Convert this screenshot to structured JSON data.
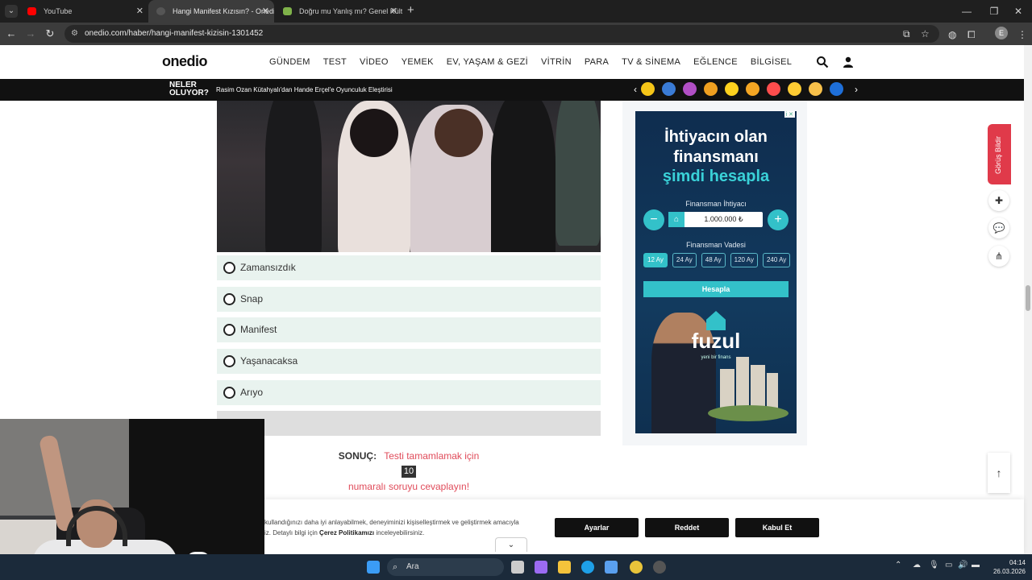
{
  "browser": {
    "tabs": [
      {
        "title": "YouTube",
        "favicon_color": "#ff0000",
        "active": false
      },
      {
        "title": "Hangi Manifest Kızısın? - Onedio",
        "favicon_color": "#555555",
        "active": true
      },
      {
        "title": "Doğru mu Yanlış mı? Genel Kültü...",
        "favicon_color": "#7fb24a",
        "active": false
      }
    ],
    "new_tab": "+",
    "url": "onedio.com/haber/hangi-manifest-kizisin-1301452",
    "profile_initial": "E"
  },
  "site": {
    "logo": "onedio",
    "menu": [
      "GÜNDEM",
      "TEST",
      "VİDEO",
      "YEMEK",
      "EV, YAŞAM & GEZİ",
      "VİTRİN",
      "PARA",
      "TV & SİNEMA",
      "EĞLENCE",
      "BİLGİSEL"
    ],
    "news_label_line1": "NELER",
    "news_label_line2": "OLUYOR?",
    "headline": "Rasim Ozan Kütahyalı'dan Hande Erçel'e Oyunculuk Eleştirisi",
    "emoji_colors": [
      "#f5c518",
      "#3a7bd5",
      "#b14fc5",
      "#f0a020",
      "#ffd21e",
      "#f5a623",
      "#ff4d4d",
      "#ffcc33",
      "#f7c04a",
      "#1e6fd9"
    ]
  },
  "quiz": {
    "answers": [
      "Zamansızdık",
      "Snap",
      "Manifest",
      "Yaşanacaksa",
      "Arıyo"
    ],
    "result_label": "SONUÇ:",
    "result_text_1": "Testi tamamlamak için",
    "result_number": "10",
    "result_text_2": "numaralı soruyu cevaplayın!"
  },
  "ad": {
    "line1": "İhtiyacın olan",
    "line2": "finansmanı",
    "line3": "şimdi hesapla",
    "amount_label": "Finansman İhtiyacı",
    "amount_value": "1.000.000 ₺",
    "term_label": "Finansman Vadesi",
    "terms": [
      "12 Ay",
      "24 Ay",
      "48 Ay",
      "120 Ay",
      "240 Ay"
    ],
    "selected_term": "12 Ay",
    "cta": "Hesapla",
    "brand": "fuzul",
    "brand_sub": "yeni bir finans",
    "accent": "#33c1c9"
  },
  "sidebar": {
    "feedback": "Görüş Bildir"
  },
  "cookie": {
    "text_1": "kullandığınızı daha iyi anlayabilmek, deneyiminizi kişiselleştirmek ve geliştirmek amacıyla",
    "text_2": "iz. Detaylı bilgi için",
    "policy_link": "Çerez Politikamızı",
    "text_3": "inceleyebilirsiniz.",
    "buttons": [
      "Ayarlar",
      "Reddet",
      "Kabul Et"
    ]
  },
  "taskbar": {
    "search_label": "Ara",
    "time": "04:14",
    "date": "26.03.2026"
  }
}
